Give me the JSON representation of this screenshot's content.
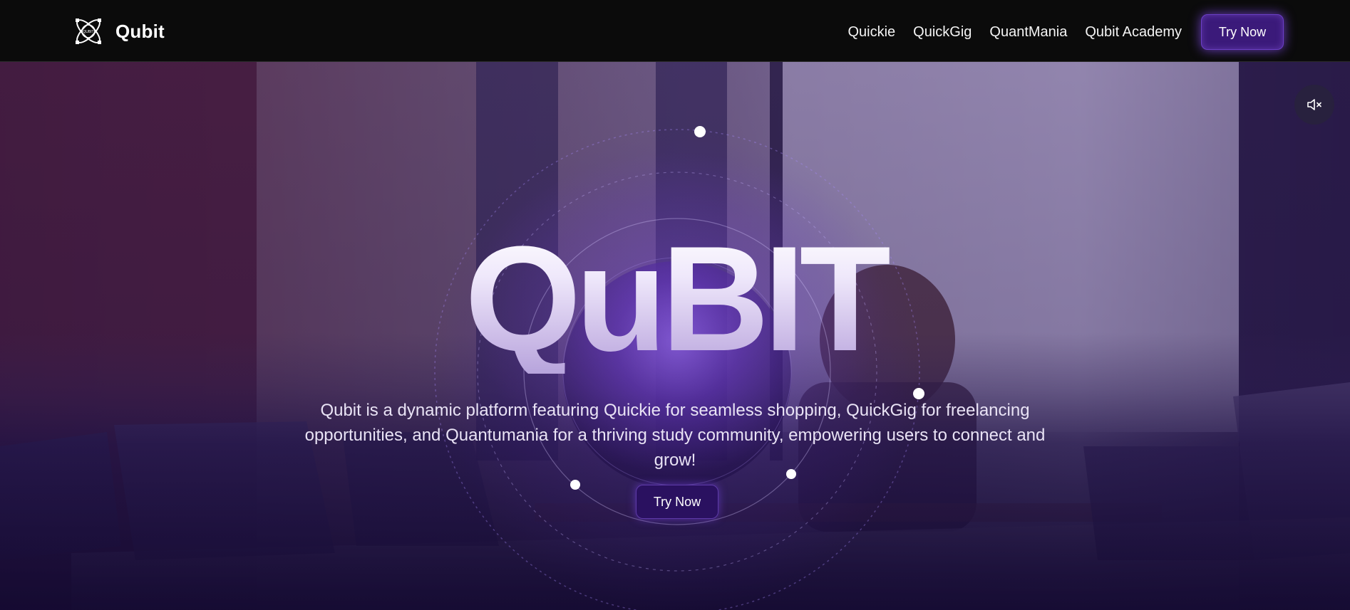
{
  "navbar": {
    "brand": {
      "name": "Qubit",
      "logo_icon": "qubit-atom-logo-icon",
      "logo_text": "QUBIT"
    },
    "links": [
      {
        "label": "Quickie"
      },
      {
        "label": "QuickGig"
      },
      {
        "label": "QuantMania"
      },
      {
        "label": "Qubit Academy"
      }
    ],
    "cta_label": "Try Now"
  },
  "hero": {
    "title": "QuBIT",
    "description": "Qubit is a dynamic platform featuring Quickie for seamless shopping, QuickGig for freelancing opportunities, and Quantumania for a thriving study community, empowering users to connect and grow!",
    "cta_label": "Try Now",
    "mute_icon": "speaker-muted-icon"
  },
  "colors": {
    "accent": "#3b1a7a",
    "glow": "#8c50ff",
    "navbar_bg": "#0b0b0b"
  }
}
